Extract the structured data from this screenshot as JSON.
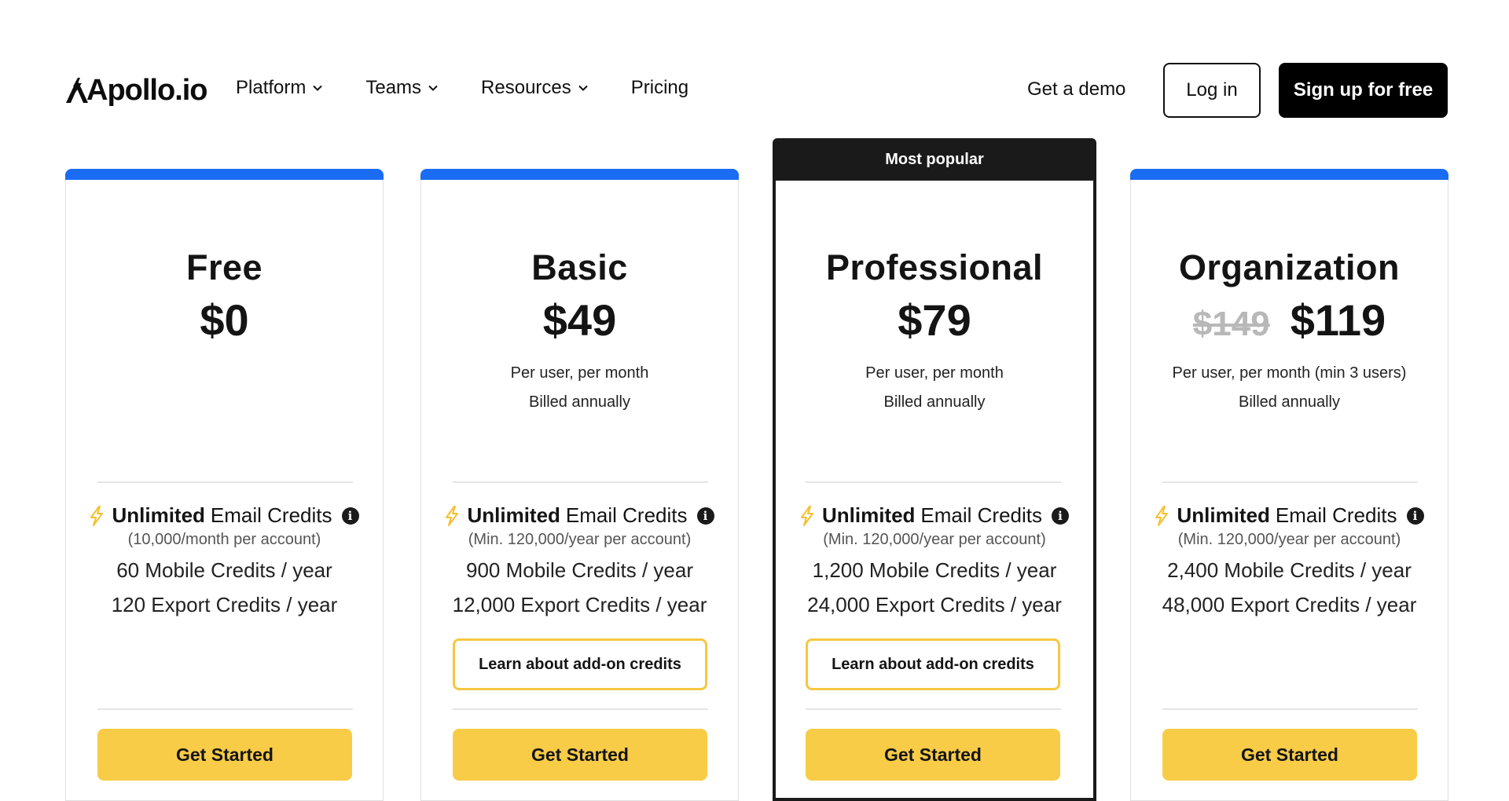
{
  "header": {
    "logo_text": "Apollo.io",
    "nav": [
      {
        "label": "Platform",
        "dropdown": true
      },
      {
        "label": "Teams",
        "dropdown": true
      },
      {
        "label": "Resources",
        "dropdown": true
      },
      {
        "label": "Pricing",
        "dropdown": false
      }
    ],
    "demo_label": "Get a demo",
    "login_label": "Log in",
    "signup_label": "Sign up for free"
  },
  "colors": {
    "accent_bar": "#1a6cf2",
    "cta_yellow": "#f8cc47",
    "addon_border": "#f5c842",
    "popular_dark": "#1a1a1a"
  },
  "plans": [
    {
      "name": "Free",
      "price": "$0",
      "old_price": "",
      "sub1": "",
      "sub2": "",
      "email_bold": "Unlimited",
      "email_rest": "Email Credits",
      "email_note": "(10,000/month per account)",
      "mobile": "60 Mobile Credits / year",
      "export": "120 Export Credits / year",
      "addon_label": "",
      "cta": "Get Started"
    },
    {
      "name": "Basic",
      "price": "$49",
      "old_price": "",
      "sub1": "Per user, per month",
      "sub2": "Billed annually",
      "email_bold": "Unlimited",
      "email_rest": "Email Credits",
      "email_note": "(Min. 120,000/year per account)",
      "mobile": "900 Mobile Credits / year",
      "export": "12,000 Export Credits / year",
      "addon_label": "Learn about add-on credits",
      "cta": "Get Started"
    },
    {
      "name": "Professional",
      "badge": "Most popular",
      "price": "$79",
      "old_price": "",
      "sub1": "Per user, per month",
      "sub2": "Billed annually",
      "email_bold": "Unlimited",
      "email_rest": "Email Credits",
      "email_note": "(Min. 120,000/year per account)",
      "mobile": "1,200 Mobile Credits / year",
      "export": "24,000 Export Credits / year",
      "addon_label": "Learn about add-on credits",
      "cta": "Get Started"
    },
    {
      "name": "Organization",
      "price": "$119",
      "old_price": "$149",
      "sub1": "Per user, per month (min 3 users)",
      "sub2": "Billed annually",
      "email_bold": "Unlimited",
      "email_rest": "Email Credits",
      "email_note": "(Min. 120,000/year per account)",
      "mobile": "2,400 Mobile Credits / year",
      "export": "48,000 Export Credits / year",
      "addon_label": "",
      "cta": "Get Started"
    }
  ]
}
